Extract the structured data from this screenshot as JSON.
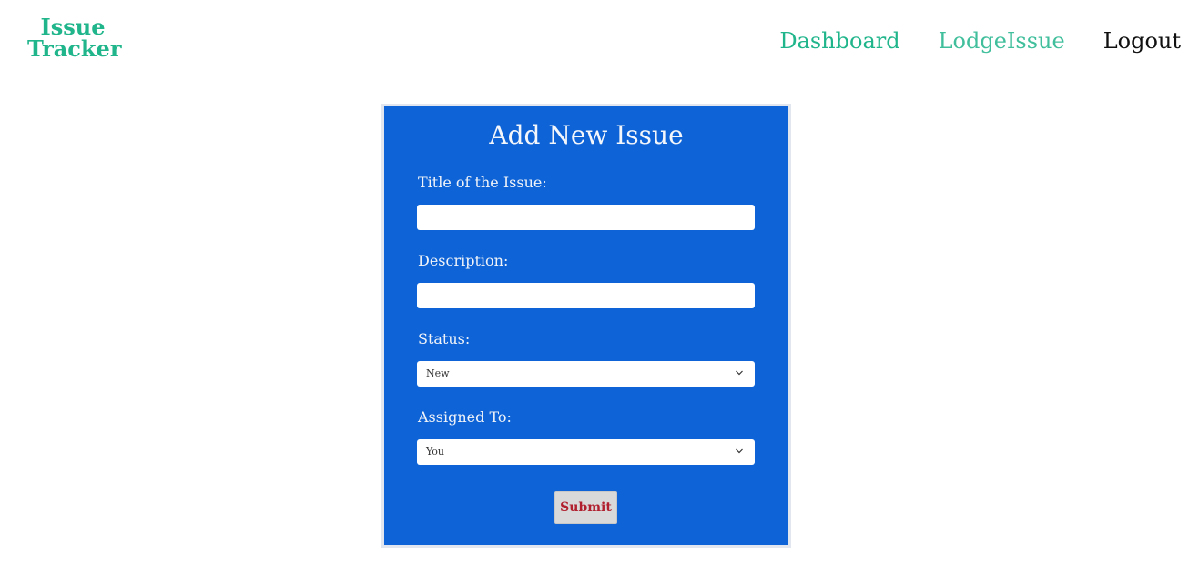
{
  "brand": {
    "line1": "Issue",
    "line2": "Tracker"
  },
  "nav": {
    "dashboard": "Dashboard",
    "lodge_issue": "LodgeIssue",
    "logout": "Logout"
  },
  "form": {
    "title": "Add New Issue",
    "title_label": "Title of the Issue:",
    "title_value": "",
    "description_label": "Description:",
    "description_value": "",
    "status_label": "Status:",
    "status_value": "New",
    "assigned_label": "Assigned To:",
    "assigned_value": "You",
    "submit_label": "Submit"
  },
  "colors": {
    "brand": "#20b58b",
    "panel": "#0e63d6",
    "submit_text": "#b0202f",
    "submit_bg": "#d9d9d9"
  },
  "icons": {
    "select_arrow": "chevron-down-icon"
  }
}
